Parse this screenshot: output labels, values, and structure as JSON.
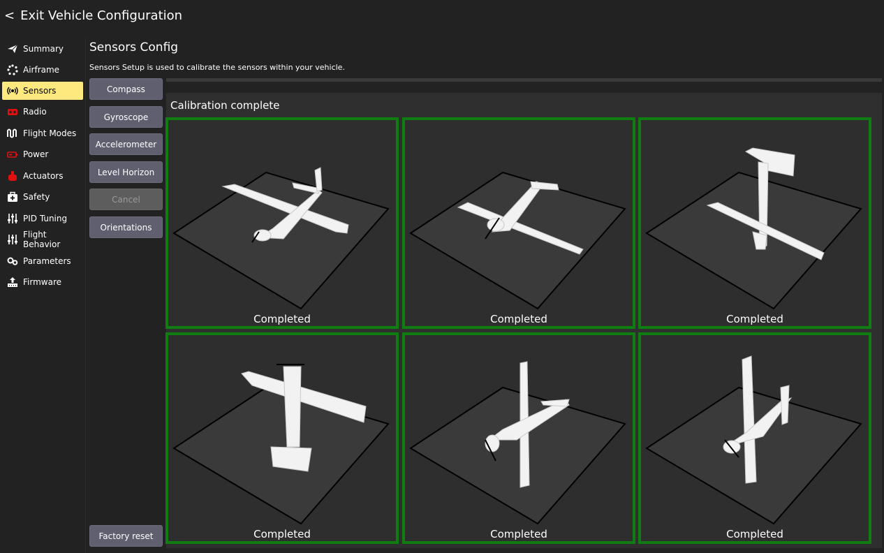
{
  "app": {
    "exit_label": "Exit Vehicle Configuration"
  },
  "sidebar": {
    "items": [
      {
        "label": "Summary",
        "icon": "paper-plane-icon",
        "active": false
      },
      {
        "label": "Airframe",
        "icon": "airframe-dots-icon",
        "active": false
      },
      {
        "label": "Sensors",
        "icon": "sensors-radio-waves-icon",
        "active": true
      },
      {
        "label": "Radio",
        "icon": "radio-transmitter-icon",
        "active": false
      },
      {
        "label": "Flight Modes",
        "icon": "flight-modes-wave-icon",
        "active": false
      },
      {
        "label": "Power",
        "icon": "battery-icon",
        "active": false
      },
      {
        "label": "Actuators",
        "icon": "actuators-icon",
        "active": false
      },
      {
        "label": "Safety",
        "icon": "first-aid-kit-icon",
        "active": false
      },
      {
        "label": "PID Tuning",
        "icon": "sliders-icon",
        "active": false
      },
      {
        "label": "Flight Behavior",
        "icon": "sliders-icon",
        "active": false
      },
      {
        "label": "Parameters",
        "icon": "gears-icon",
        "active": false
      },
      {
        "label": "Firmware",
        "icon": "firmware-upload-icon",
        "active": false
      }
    ]
  },
  "page": {
    "title": "Sensors Config",
    "description": "Sensors Setup is used to calibrate the sensors within your vehicle."
  },
  "buttons": {
    "compass": "Compass",
    "gyroscope": "Gyroscope",
    "accelerometer": "Accelerometer",
    "level_horizon": "Level Horizon",
    "cancel": "Cancel",
    "orientations": "Orientations",
    "factory_reset": "Factory reset"
  },
  "calibration": {
    "title": "Calibration complete",
    "border_color": "#0f7d12",
    "tiles": [
      {
        "orientation": "level",
        "status": "Completed"
      },
      {
        "orientation": "upside-down",
        "status": "Completed"
      },
      {
        "orientation": "nose-down",
        "status": "Completed"
      },
      {
        "orientation": "nose-up",
        "status": "Completed"
      },
      {
        "orientation": "left-side",
        "status": "Completed"
      },
      {
        "orientation": "right-side",
        "status": "Completed"
      }
    ]
  },
  "colors": {
    "accent": "#fde97e",
    "button": "#5f5f70",
    "complete": "#0f7d12",
    "warn_icon": "#e01010"
  }
}
